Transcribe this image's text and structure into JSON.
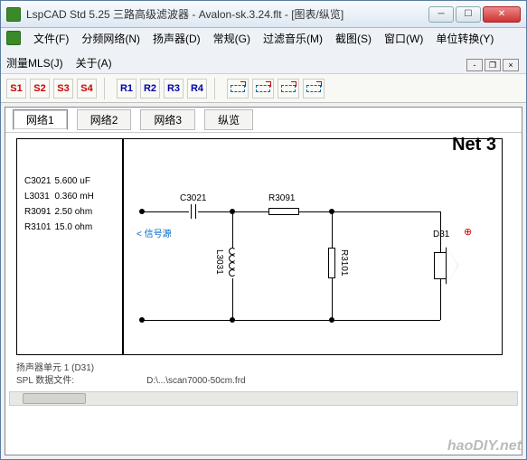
{
  "window": {
    "title": "LspCAD Std 5.25 三路高级滤波器 - Avalon-sk.3.24.flt - [图表/纵览]"
  },
  "menu": {
    "file": "文件(F)",
    "crossover": "分频网络(N)",
    "speaker": "扬声器(D)",
    "general": "常规(G)",
    "filter": "过滤音乐(M)",
    "capture": "截图(S)",
    "window": "窗口(W)",
    "unit": "单位转换(Y)",
    "mls": "测量MLS(J)",
    "about": "关于(A)"
  },
  "toolbar": {
    "s": [
      "S1",
      "S2",
      "S3",
      "S4"
    ],
    "r": [
      "R1",
      "R2",
      "R3",
      "R4"
    ]
  },
  "tabs": {
    "items": [
      "网络1",
      "网络2",
      "网络3",
      "纵览"
    ],
    "active": 0
  },
  "net_title": "Net 3",
  "components": [
    {
      "ref": "C3021",
      "val": "5.600 uF"
    },
    {
      "ref": "L3031",
      "val": "0.360 mH"
    },
    {
      "ref": "R3091",
      "val": "2.50 ohm"
    },
    {
      "ref": "R3101",
      "val": "15.0 ohm"
    }
  ],
  "labels": {
    "source": "< 信号源",
    "c3021": "C3021",
    "r3091": "R3091",
    "l3031": "L3031",
    "r3101": "R3101",
    "d31": "D31"
  },
  "info": {
    "line1_l": "扬声器单元 1 (D31)",
    "line2_l": "SPL 数据文件:",
    "line2_r": "D:\\...\\scan7000-50cm.frd"
  },
  "watermark": "haoDIY.net"
}
